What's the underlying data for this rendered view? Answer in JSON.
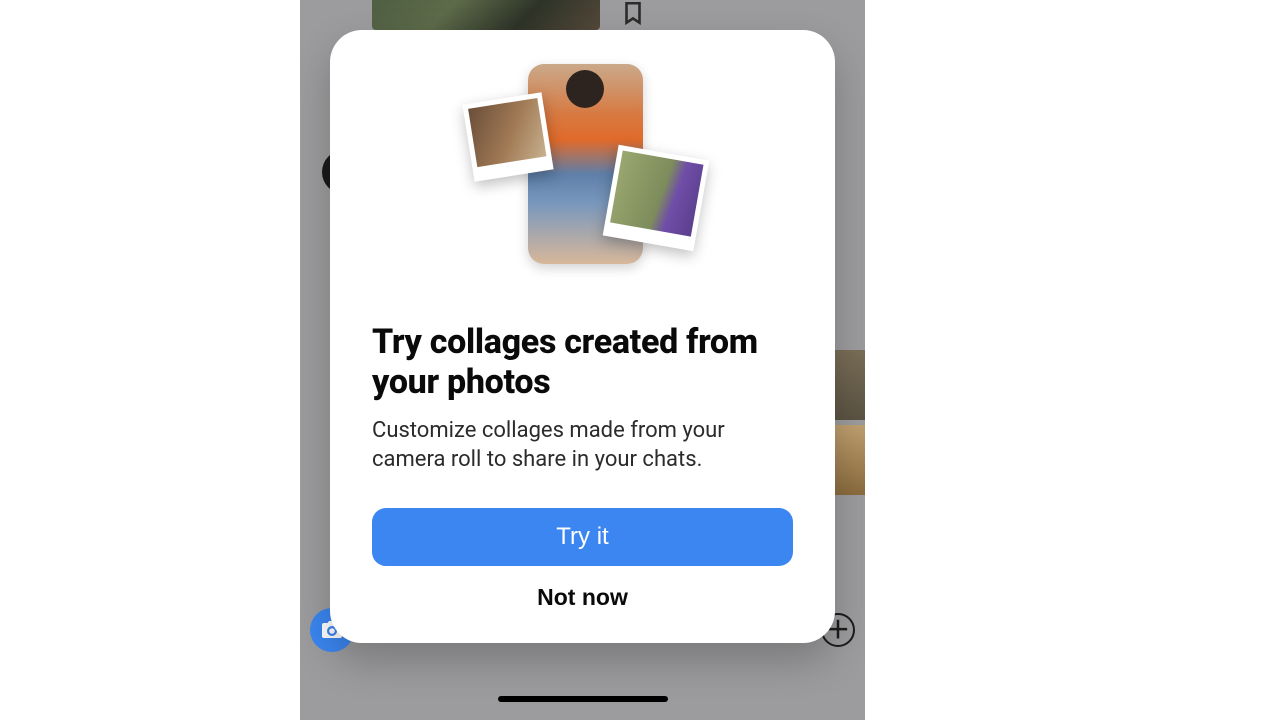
{
  "modal": {
    "title": "Try collages created from your photos",
    "body": "Customize collages made from your camera roll to share in your chats.",
    "primary_label": "Try it",
    "secondary_label": "Not now"
  },
  "toolbar": {
    "icons": {
      "camera": "camera-icon",
      "mic": "microphone-icon",
      "image": "photo-icon",
      "sticker": "sticker-icon",
      "plus": "plus-icon",
      "bookmark": "bookmark-icon"
    }
  },
  "colors": {
    "accent": "#3b86f0",
    "overlay": "#9c9c9e"
  }
}
